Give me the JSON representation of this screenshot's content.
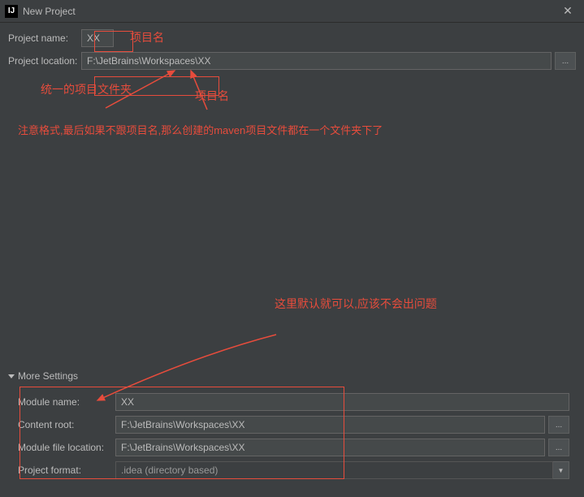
{
  "window": {
    "title": "New Project",
    "icon_label": "IJ"
  },
  "form": {
    "project_name_label": "Project name:",
    "project_name_value": "XX",
    "project_location_label": "Project location:",
    "project_location_value": "F:\\JetBrains\\Workspaces\\XX"
  },
  "more_settings": {
    "header": "More Settings",
    "module_name_label": "Module name:",
    "module_name_value": "XX",
    "content_root_label": "Content root:",
    "content_root_value": "F:\\JetBrains\\Workspaces\\XX",
    "module_file_location_label": "Module file location:",
    "module_file_location_value": "F:\\JetBrains\\Workspaces\\XX",
    "project_format_label": "Project format:",
    "project_format_value": ".idea (directory based)"
  },
  "annotations": {
    "name": "项目名",
    "folder": "统一的项目文件夹",
    "projname": "项目名",
    "note": "注意格式,最后如果不跟项目名,那么创建的maven项目文件都在一个文件夹下了",
    "settings": "这里默认就可以,应该不会出问题"
  },
  "icons": {
    "browse": "...",
    "dropdown": "▼",
    "close": "✕"
  }
}
